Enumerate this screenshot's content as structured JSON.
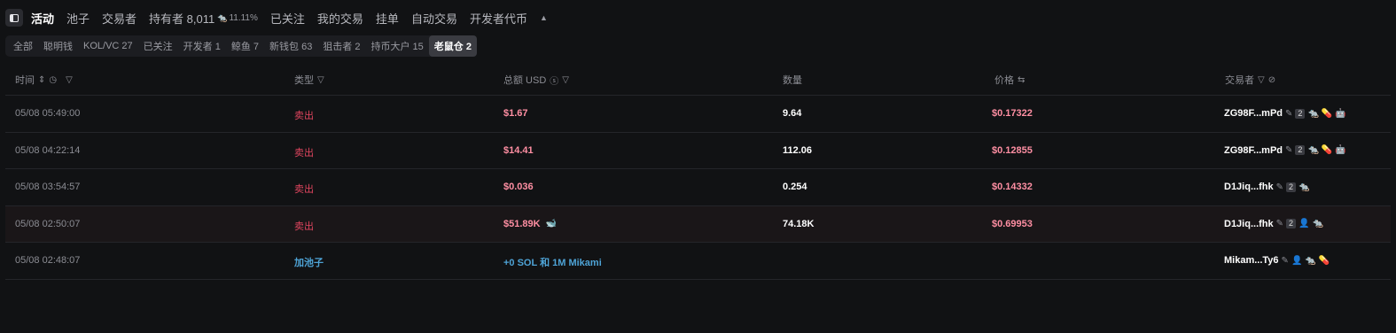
{
  "topbar": {
    "tabs": [
      {
        "label": "活动",
        "active": true
      },
      {
        "label": "池子"
      },
      {
        "label": "交易者"
      },
      {
        "label": "持有者 8,011",
        "sub": "11.11%"
      },
      {
        "label": "已关注"
      },
      {
        "label": "我的交易"
      },
      {
        "label": "挂单"
      },
      {
        "label": "自动交易"
      },
      {
        "label": "开发者代币"
      }
    ]
  },
  "filters": {
    "chips": [
      "全部",
      "聪明钱",
      "KOL/VC 27",
      "已关注",
      "开发者 1",
      "鲸鱼 7",
      "新钱包 63",
      "狙击者 2",
      "持币大户 15",
      "老鼠仓 2"
    ],
    "active_index": 9
  },
  "table": {
    "headers": {
      "time": "时间",
      "type": "类型",
      "total": "总额 USD",
      "qty": "数量",
      "price": "价格",
      "trader": "交易者"
    },
    "rows": [
      {
        "time": "05/08 05:49:00",
        "type": "卖出",
        "total": "$1.67",
        "qty": "9.64",
        "price": "$0.17322",
        "trader": "ZG98F...mPd",
        "badge": "2"
      },
      {
        "time": "05/08 04:22:14",
        "type": "卖出",
        "total": "$14.41",
        "qty": "112.06",
        "price": "$0.12855",
        "trader": "ZG98F...mPd",
        "badge": "2"
      },
      {
        "time": "05/08 03:54:57",
        "type": "卖出",
        "total": "$0.036",
        "qty": "0.254",
        "price": "$0.14332",
        "trader": "D1Jiq...fhk",
        "badge": "2"
      },
      {
        "time": "05/08 02:50:07",
        "type": "卖出",
        "total": "$51.89K",
        "qty": "74.18K",
        "price": "$0.69953",
        "trader": "D1Jiq...fhk",
        "badge": "2"
      },
      {
        "time": "05/08 02:48:07",
        "type": "加池子",
        "total": "+0 SOL 和 1M Mikami",
        "qty": "",
        "price": "",
        "trader": "Mikam...Ty6",
        "badge": ""
      }
    ]
  },
  "colors": {
    "background": "#111214",
    "sell": "#e0455f",
    "sell_value": "#ff8fa3",
    "add_pool": "#4ea3d6",
    "green": "#55c76b"
  }
}
